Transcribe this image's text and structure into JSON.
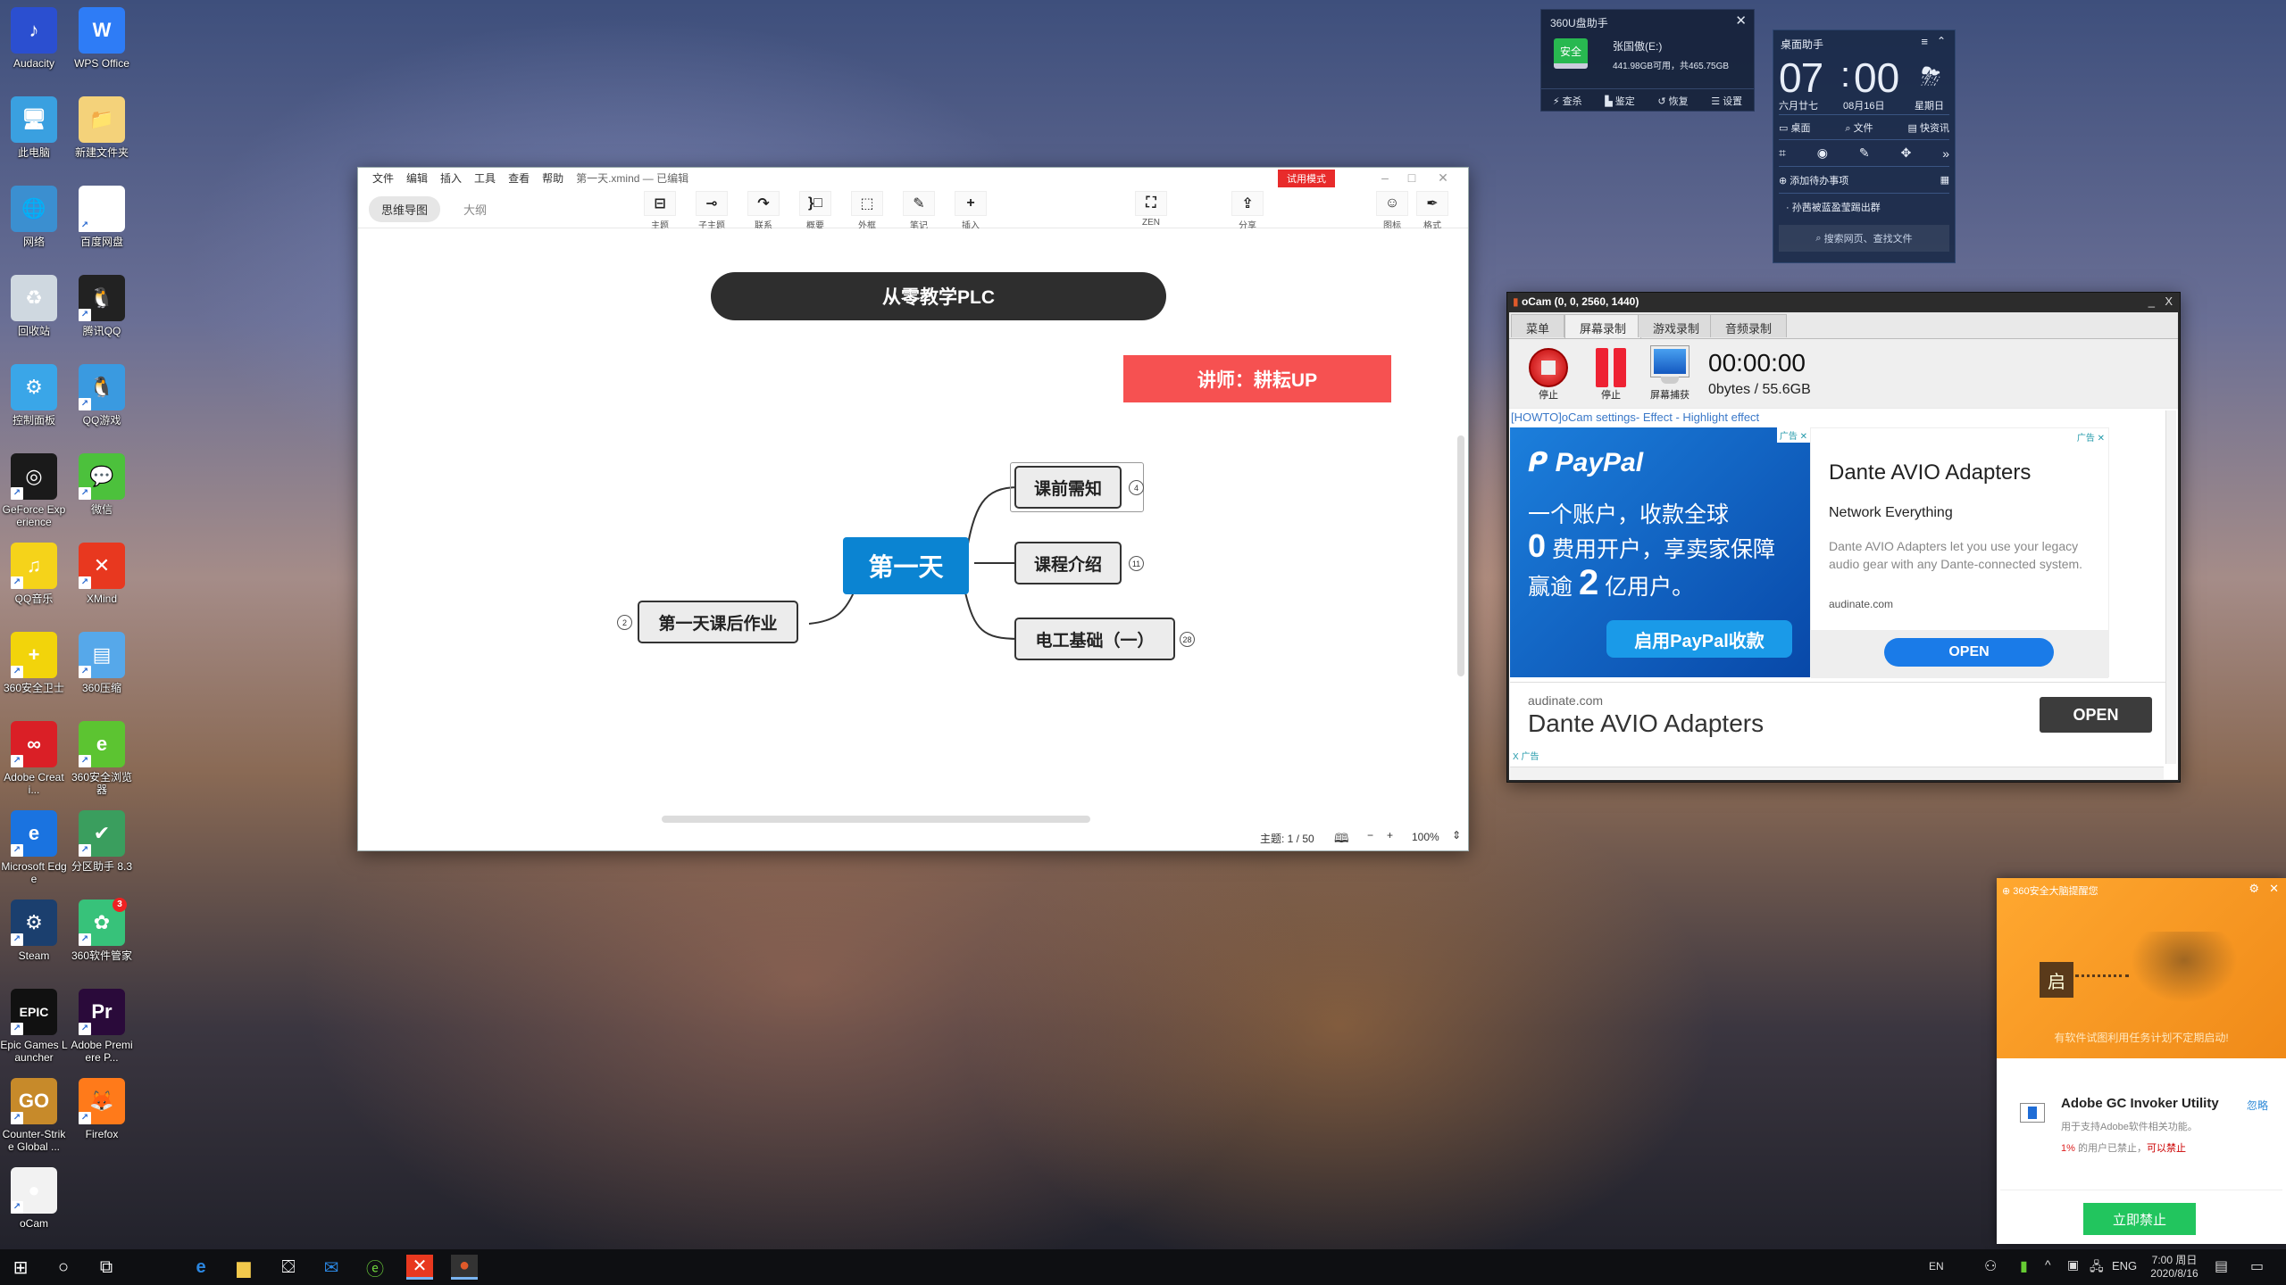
{
  "desktop_icons": [
    {
      "label": "Audacity",
      "icon": "audacity-icon",
      "color": "#2b4fd0",
      "glyph": "♪"
    },
    {
      "label": "WPS Office",
      "icon": "wps-icon",
      "color": "#2e7cf6",
      "glyph": "W"
    },
    {
      "label": "此电脑",
      "icon": "this-pc-icon",
      "color": "#3aa0e0",
      "glyph": "🖥"
    },
    {
      "label": "新建文件夹",
      "icon": "folder-icon",
      "color": "#f4d27a",
      "glyph": "📁"
    },
    {
      "label": "网络",
      "icon": "network-icon",
      "color": "#3b8fd0",
      "glyph": "🌐"
    },
    {
      "label": "百度网盘",
      "icon": "baidu-netdisk-icon",
      "color": "#ffffff",
      "glyph": "∞"
    },
    {
      "label": "回收站",
      "icon": "recycle-bin-icon",
      "color": "#cfd8e0",
      "glyph": "♻"
    },
    {
      "label": "腾讯QQ",
      "icon": "qq-icon",
      "color": "#222222",
      "glyph": "🐧"
    },
    {
      "label": "控制面板",
      "icon": "control-panel-icon",
      "color": "#3aa6e8",
      "glyph": "⚙"
    },
    {
      "label": "QQ游戏",
      "icon": "qq-game-icon",
      "color": "#3a9ae0",
      "glyph": "🐧"
    },
    {
      "label": "GeForce Experience",
      "icon": "geforce-icon",
      "color": "#1a1a1a",
      "glyph": "◎"
    },
    {
      "label": "微信",
      "icon": "wechat-icon",
      "color": "#4cc13c",
      "glyph": "💬"
    },
    {
      "label": "QQ音乐",
      "icon": "qq-music-icon",
      "color": "#f5d31a",
      "glyph": "♫"
    },
    {
      "label": "XMind",
      "icon": "xmind-icon",
      "color": "#e8381f",
      "glyph": "✕"
    },
    {
      "label": "360安全卫士",
      "icon": "360-safe-icon",
      "color": "#f2d40b",
      "glyph": "+"
    },
    {
      "label": "360压缩",
      "icon": "360-zip-icon",
      "color": "#56a8ea",
      "glyph": "▤"
    },
    {
      "label": "Adobe Creati...",
      "icon": "adobe-cc-icon",
      "color": "#da1f26",
      "glyph": "∞"
    },
    {
      "label": "360安全浏览器",
      "icon": "360-browser-icon",
      "color": "#5cc431",
      "glyph": "e"
    },
    {
      "label": "Microsoft Edge",
      "icon": "edge-icon",
      "color": "#1a73e0",
      "glyph": "e"
    },
    {
      "label": "分区助手 8.3",
      "icon": "partition-assistant-icon",
      "color": "#3a9e5e",
      "glyph": "✔"
    },
    {
      "label": "Steam",
      "icon": "steam-icon",
      "color": "#1b3f6e",
      "glyph": "⚙"
    },
    {
      "label": "360软件管家",
      "icon": "360-software-manager-icon",
      "color": "#37c27a",
      "glyph": "✿",
      "badge": "3"
    },
    {
      "label": "Epic Games Launcher",
      "icon": "epic-games-icon",
      "color": "#111111",
      "glyph": "EPIC"
    },
    {
      "label": "Adobe Premiere P...",
      "icon": "premiere-icon",
      "color": "#2a0a3a",
      "glyph": "Pr"
    },
    {
      "label": "Counter-Strike Global ...",
      "icon": "csgo-icon",
      "color": "#c78a2a",
      "glyph": "GO"
    },
    {
      "label": "Firefox",
      "icon": "firefox-icon",
      "color": "#ff7a1a",
      "glyph": "🦊"
    },
    {
      "label": "oCam",
      "icon": "ocam-icon",
      "color": "#f2f2f2",
      "glyph": "●"
    }
  ],
  "xmind": {
    "menu": [
      "文件",
      "编辑",
      "插入",
      "工具",
      "查看",
      "帮助"
    ],
    "title": "第一天.xmind — 已编辑",
    "trial_badge": "试用模式",
    "view_tabs": [
      "思维导图",
      "大纲"
    ],
    "tools": [
      {
        "label": "主题",
        "glyph": "⊟"
      },
      {
        "label": "子主题",
        "glyph": "⊸"
      },
      {
        "label": "联系",
        "glyph": "↷"
      },
      {
        "label": "概要",
        "glyph": "}□"
      },
      {
        "label": "外框",
        "glyph": "⬚"
      },
      {
        "label": "笔记",
        "glyph": "✎"
      },
      {
        "label": "插入",
        "glyph": "+"
      }
    ],
    "zen_label": "ZEN",
    "share_label": "分享",
    "icon_label": "图标",
    "format_label": "格式",
    "map": {
      "title_node": "从零教学PLC",
      "lecturer_node": "讲师：耕耘UP",
      "central": "第一天",
      "left_topic": {
        "label": "第一天课后作业",
        "count": "2"
      },
      "right_topics": [
        {
          "label": "课前需知",
          "count": "4"
        },
        {
          "label": "课程介绍",
          "count": "11"
        },
        {
          "label": "电工基础（一）",
          "count": "28"
        }
      ]
    },
    "status": {
      "topics": "主题: 1 / 50",
      "zoom": "100%",
      "minus": "−",
      "plus": "+"
    }
  },
  "udisk": {
    "title": "360U盘助手",
    "badge": "安全",
    "drive": "张国傲(E:)",
    "space": "441.98GB可用，共465.75GB",
    "actions": [
      "查杀",
      "鉴定",
      "恢复",
      "设置"
    ]
  },
  "desk_helper": {
    "title": "桌面助手",
    "hour": "07",
    "minute": "00",
    "lunar": "六月廿七",
    "date": "08月16日",
    "weekday": "星期日",
    "quick": [
      "桌面",
      "文件",
      "快资讯"
    ],
    "todo": "添加待办事项",
    "news": "孙茜被蓝盈莹踢出群",
    "search_placeholder": "搜索网页、查找文件"
  },
  "ocam": {
    "title": "oCam (0, 0, 2560, 1440)",
    "tabs": [
      "菜单",
      "屏幕录制",
      "游戏录制",
      "音频录制"
    ],
    "buttons": [
      "停止",
      "停止",
      "屏幕捕获"
    ],
    "timer": "00:00:00",
    "size": "0bytes / 55.6GB",
    "howto_link": "[HOWTO]oCam settings- Effect - Highlight effect",
    "ad_tag": "广告",
    "paypal": {
      "brand": "PayPal",
      "line1": "一个账户，收款全球",
      "line2_num": "0",
      "line2": "费用开户，享卖家保障",
      "line3_pre": "赢逾",
      "line3_num": "2",
      "line3": "亿用户。",
      "cta": "启用PayPal收款"
    },
    "dante": {
      "title": "Dante AVIO Adapters",
      "subtitle": "Network Everything",
      "body": "Dante AVIO Adapters let you use your legacy audio gear with any Dante-connected system.",
      "domain": "audinate.com",
      "cta": "OPEN"
    },
    "banner": {
      "domain": "audinate.com",
      "title": "Dante AVIO Adapters",
      "cta": "OPEN",
      "ad_tag": "X 广告"
    }
  },
  "popup360": {
    "header": "360安全大脑提醒您",
    "headline": "有软件试图利用任务计划不定期启动!",
    "badge_char": "启",
    "app_name": "Adobe GC Invoker Utility",
    "desc": "用于支持Adobe软件相关功能。",
    "stat_pct": "1%",
    "stat_text": "的用户已禁止，",
    "stat_link": "可以禁止",
    "ignore": "忽略",
    "cta": "立即禁止"
  },
  "taskbar": {
    "pinned": [
      "edge-icon",
      "file-explorer-icon",
      "store-icon",
      "mail-icon",
      "360-browser-icon",
      "xmind-icon",
      "ocam-icon"
    ],
    "ime": "EN",
    "lang": "ENG",
    "time": "7:00 周日",
    "date": "2020/8/16"
  }
}
